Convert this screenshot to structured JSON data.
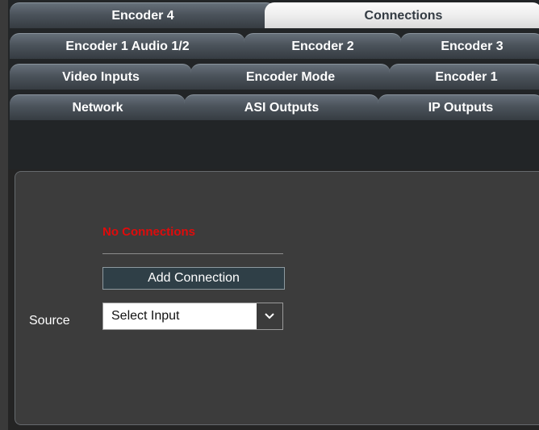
{
  "tabs": {
    "row1": [
      {
        "label": "Encoder 4",
        "active": false
      },
      {
        "label": "Connections",
        "active": true
      }
    ],
    "row2": [
      {
        "label": "Encoder 1 Audio 1/2",
        "active": false
      },
      {
        "label": "Encoder 2",
        "active": false
      },
      {
        "label": "Encoder 3",
        "active": false
      }
    ],
    "row3": [
      {
        "label": "Video Inputs",
        "active": false
      },
      {
        "label": "Encoder Mode",
        "active": false
      },
      {
        "label": "Encoder 1",
        "active": false
      }
    ],
    "row4": [
      {
        "label": "Network",
        "active": false
      },
      {
        "label": "ASI Outputs",
        "active": false
      },
      {
        "label": "IP Outputs",
        "active": false
      }
    ]
  },
  "connections": {
    "status": "No Connections",
    "add_button_label": "Add Connection",
    "source_label": "Source",
    "source_select_value": "Select Input"
  },
  "colors": {
    "status": "#e00b0b",
    "active_tab": "#ececec",
    "inactive_tab": "#4b535b",
    "panel": "#3c3c3c",
    "button": "#2f3f47"
  },
  "icons": {
    "select_arrow": "chevron-down-icon"
  }
}
